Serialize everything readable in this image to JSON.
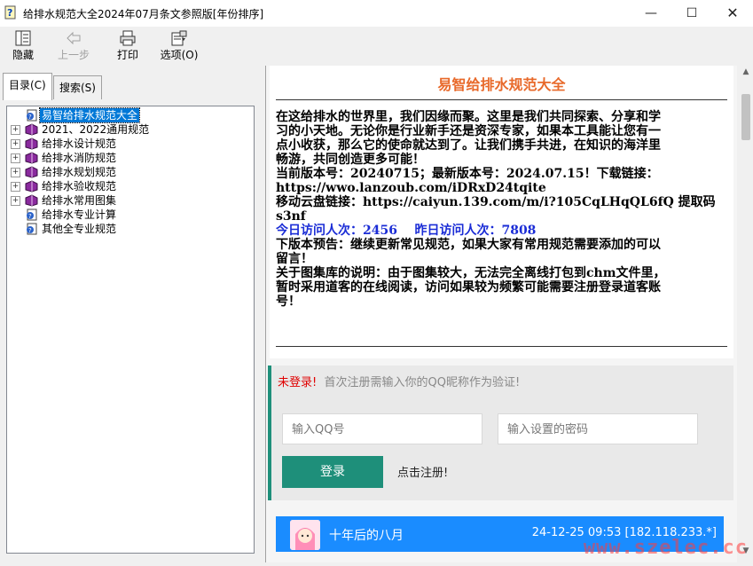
{
  "window": {
    "title": "给排水规范大全2024年07月条文参照版[年份排序]",
    "icon": "help-document-icon"
  },
  "toolbar": {
    "hide_label": "隐藏",
    "back_label": "上一步",
    "print_label": "打印",
    "options_label": "选项(O)"
  },
  "tabs": {
    "contents_label": "目录(C)",
    "search_label": "搜索(S)"
  },
  "tree": {
    "items": [
      {
        "label": "易智给排水规范大全",
        "expandable": false,
        "icon": "help-page-icon",
        "selected": true
      },
      {
        "label": "2021、2022通用规范",
        "expandable": true,
        "icon": "book-icon"
      },
      {
        "label": "给排水设计规范",
        "expandable": true,
        "icon": "book-icon"
      },
      {
        "label": "给排水消防规范",
        "expandable": true,
        "icon": "book-icon"
      },
      {
        "label": "给排水规划规范",
        "expandable": true,
        "icon": "book-icon"
      },
      {
        "label": "给排水验收规范",
        "expandable": true,
        "icon": "book-icon"
      },
      {
        "label": "给排水常用图集",
        "expandable": true,
        "icon": "book-icon"
      },
      {
        "label": "给排水专业计算",
        "expandable": false,
        "icon": "help-page-icon"
      },
      {
        "label": "其他全专业规范",
        "expandable": false,
        "icon": "help-page-icon"
      }
    ]
  },
  "content": {
    "heading": "易智给排水规范大全",
    "lines": [
      {
        "text": "在这给排水的世界里，我们因缘而聚。这里是我们共同探索、分享和学",
        "style": "normal"
      },
      {
        "text": "习的小天地。无论你是行业新手还是资深专家，如果本工具能让您有一",
        "style": "normal"
      },
      {
        "text": "点小收获，那么它的使命就达到了。让我们携手共进，在知识的海洋里",
        "style": "normal"
      },
      {
        "text": "畅游，共同创造更多可能！",
        "style": "normal"
      },
      {
        "text": "当前版本号：20240715；最新版本号：2024.07.15！下载链接：",
        "style": "normal"
      },
      {
        "text": "https://wwo.lanzoub.com/iDRxD24tqite",
        "style": "normal"
      },
      {
        "text": "移动云盘链接：https://caiyun.139.com/m/i?105CqLHqQL6fQ 提取码",
        "style": "normal"
      },
      {
        "text": "s3nf",
        "style": "normal"
      },
      {
        "text": "今日访问人次：2456    昨日访问人次：7808",
        "style": "blue"
      },
      {
        "text": "下版本预告：继续更新常见规范，如果大家有常用规范需要添加的可以",
        "style": "normal"
      },
      {
        "text": "留言！",
        "style": "normal"
      },
      {
        "text": "关于图集库的说明：由于图集较大，无法完全离线打包到chm文件里，",
        "style": "normal"
      },
      {
        "text": "暂时采用道客的在线阅读，访问如果较为频繁可能需要注册登录道客账",
        "style": "normal"
      },
      {
        "text": "号！",
        "style": "normal"
      }
    ]
  },
  "login": {
    "status": "未登录",
    "status_punct": "!",
    "hint": "首次注册需输入你的QQ昵称作为验证!",
    "qq_placeholder": "输入QQ号",
    "password_placeholder": "输入设置的密码",
    "login_button": "登录",
    "register_link": "点击注册!"
  },
  "comment": {
    "username": "十年后的八月",
    "timestamp": "24-12-25 09:53",
    "ip": "[182.118.233.*]"
  },
  "watermark": "www.szelec.cc",
  "colors": {
    "heading": "#e8692a",
    "visits": "#1a2cd6",
    "accent_green": "#1e8f7a",
    "comment_blue": "#1a8cff",
    "not_logged_in": "#e00000"
  }
}
